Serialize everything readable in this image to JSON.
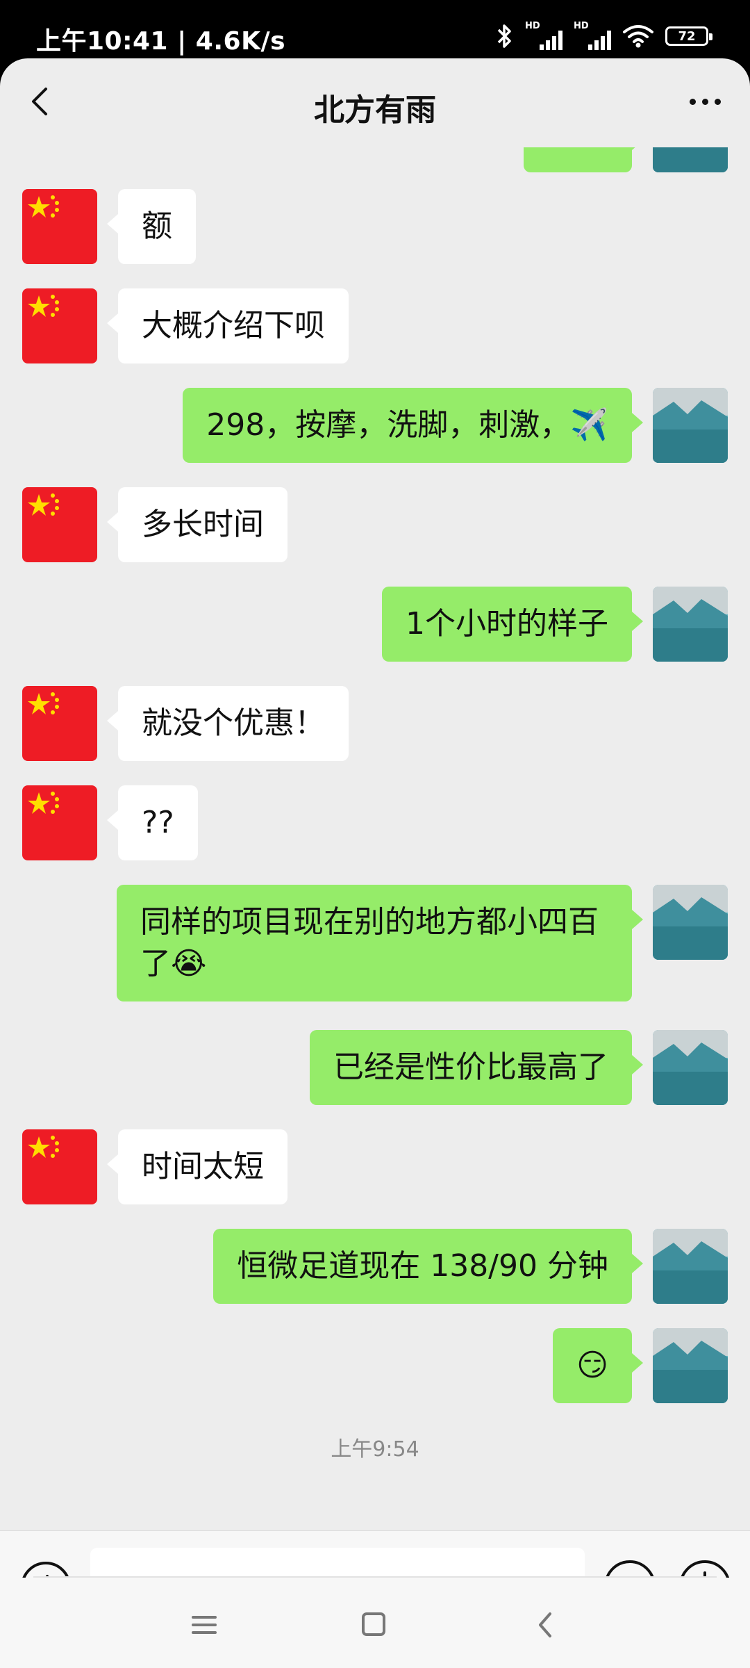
{
  "status_bar": {
    "time_speed": "上午10:41 | 4.6K/s",
    "signal_label": "HD",
    "battery": "72"
  },
  "header": {
    "title": "北方有雨"
  },
  "messages": [
    {
      "side": "in",
      "text": "额"
    },
    {
      "side": "in",
      "text": "大概介绍下呗"
    },
    {
      "side": "out",
      "text": "298，按摩，洗脚，刺激，✈️"
    },
    {
      "side": "in",
      "text": "多长时间"
    },
    {
      "side": "out",
      "text": "1个小时的样子"
    },
    {
      "side": "in",
      "text": "就没个优惠！"
    },
    {
      "side": "in",
      "text": "??"
    },
    {
      "side": "out",
      "text": "同样的项目现在别的地方都小四百了😭"
    },
    {
      "side": "out",
      "text": "已经是性价比最高了"
    },
    {
      "side": "in",
      "text": "时间太短"
    },
    {
      "side": "out",
      "text": "恒微足道现在 138/90 分钟"
    },
    {
      "side": "out",
      "text": "😏"
    }
  ],
  "timestamp": "上午9:54",
  "input": {
    "placeholder": "",
    "value": ""
  },
  "colors": {
    "chat_background": "#ededed",
    "outgoing_bubble": "#95ec69",
    "incoming_bubble": "#ffffff",
    "flag_red": "#ee1c25",
    "flag_yellow": "#ffde00"
  },
  "icons": [
    "back-arrow-icon",
    "more-icon",
    "bluetooth-icon",
    "signal-icon",
    "wifi-icon",
    "battery-icon",
    "voice-icon",
    "emoji-icon",
    "plus-icon",
    "menu-icon",
    "home-icon",
    "nav-back-icon"
  ]
}
